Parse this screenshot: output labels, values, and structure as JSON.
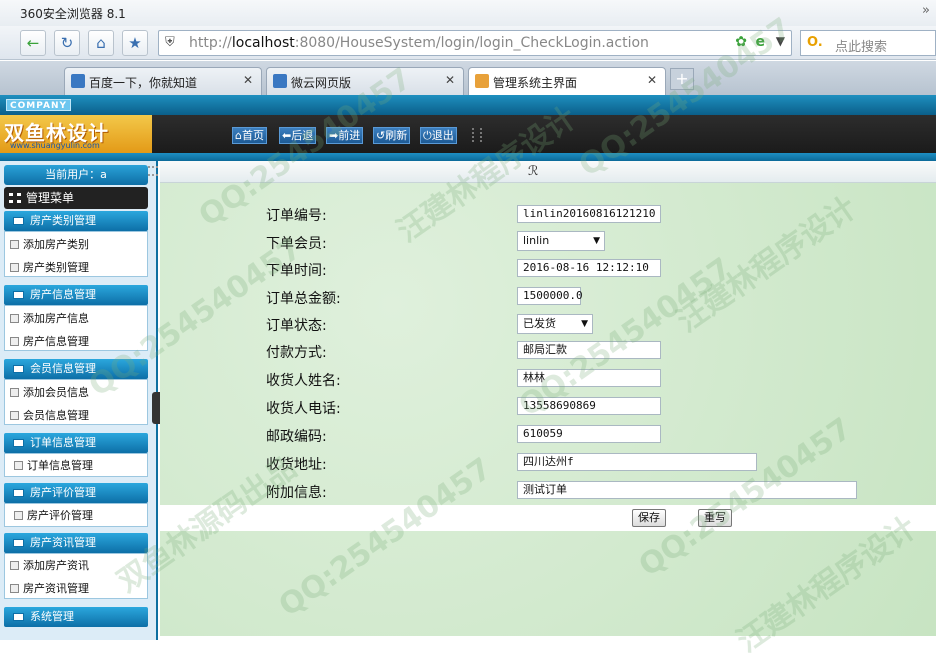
{
  "browser": {
    "title": "360安全浏览器 8.1",
    "url_host": "localhost",
    "url_prefix": "http://",
    "url_rest": ":8080/HouseSystem/login/login_CheckLogin.action",
    "search_placeholder": "点此搜索",
    "tabs": [
      {
        "label": "百度一下，你就知道"
      },
      {
        "label": "微云网页版"
      },
      {
        "label": "管理系统主界面"
      }
    ]
  },
  "banner": {
    "company_tag": "COMPANY",
    "logo_text": "双鱼林设计",
    "logo_url": "www.shuangyulin.com"
  },
  "toolbar": {
    "home": "首页",
    "back": "后退",
    "forward": "前进",
    "refresh": "刷新",
    "logout": "退出"
  },
  "sidebar": {
    "user_label": "当前用户：a",
    "main_menu": "管理菜单",
    "sections": [
      {
        "title": "房产类别管理",
        "items": [
          "添加房产类别",
          "房产类别管理"
        ]
      },
      {
        "title": "房产信息管理",
        "items": [
          "添加房产信息",
          "房产信息管理"
        ]
      },
      {
        "title": "会员信息管理",
        "items": [
          "添加会员信息",
          "会员信息管理"
        ]
      },
      {
        "title": "订单信息管理",
        "items": [
          "订单信息管理"
        ]
      },
      {
        "title": "房产评价管理",
        "items": [
          "房产评价管理"
        ]
      },
      {
        "title": "房产资讯管理",
        "items": [
          "添加房产资讯",
          "房产资讯管理"
        ]
      },
      {
        "title": "系统管理",
        "items": []
      }
    ]
  },
  "form": {
    "top_glyph": "ℛ",
    "fields": [
      {
        "label": "订单编号:",
        "value": "linlin20160816121210"
      },
      {
        "label": "下单会员:",
        "value": "linlin"
      },
      {
        "label": "下单时间:",
        "value": "2016-08-16 12:12:10"
      },
      {
        "label": "订单总金额:",
        "value": "1500000.0"
      },
      {
        "label": "订单状态:",
        "value": "已发货"
      },
      {
        "label": "付款方式:",
        "value": "邮局汇款"
      },
      {
        "label": "收货人姓名:",
        "value": "林林"
      },
      {
        "label": "收货人电话:",
        "value": "13558690869"
      },
      {
        "label": "邮政编码:",
        "value": "610059"
      },
      {
        "label": "收货地址:",
        "value": "四川达州f"
      },
      {
        "label": "附加信息:",
        "value": "测试订单"
      }
    ],
    "save": "保存",
    "reset": "重写"
  },
  "watermark": {
    "qq": "QQ:254540457",
    "text1": "双鱼林源码出品",
    "text2": "汪建林程序设计"
  }
}
